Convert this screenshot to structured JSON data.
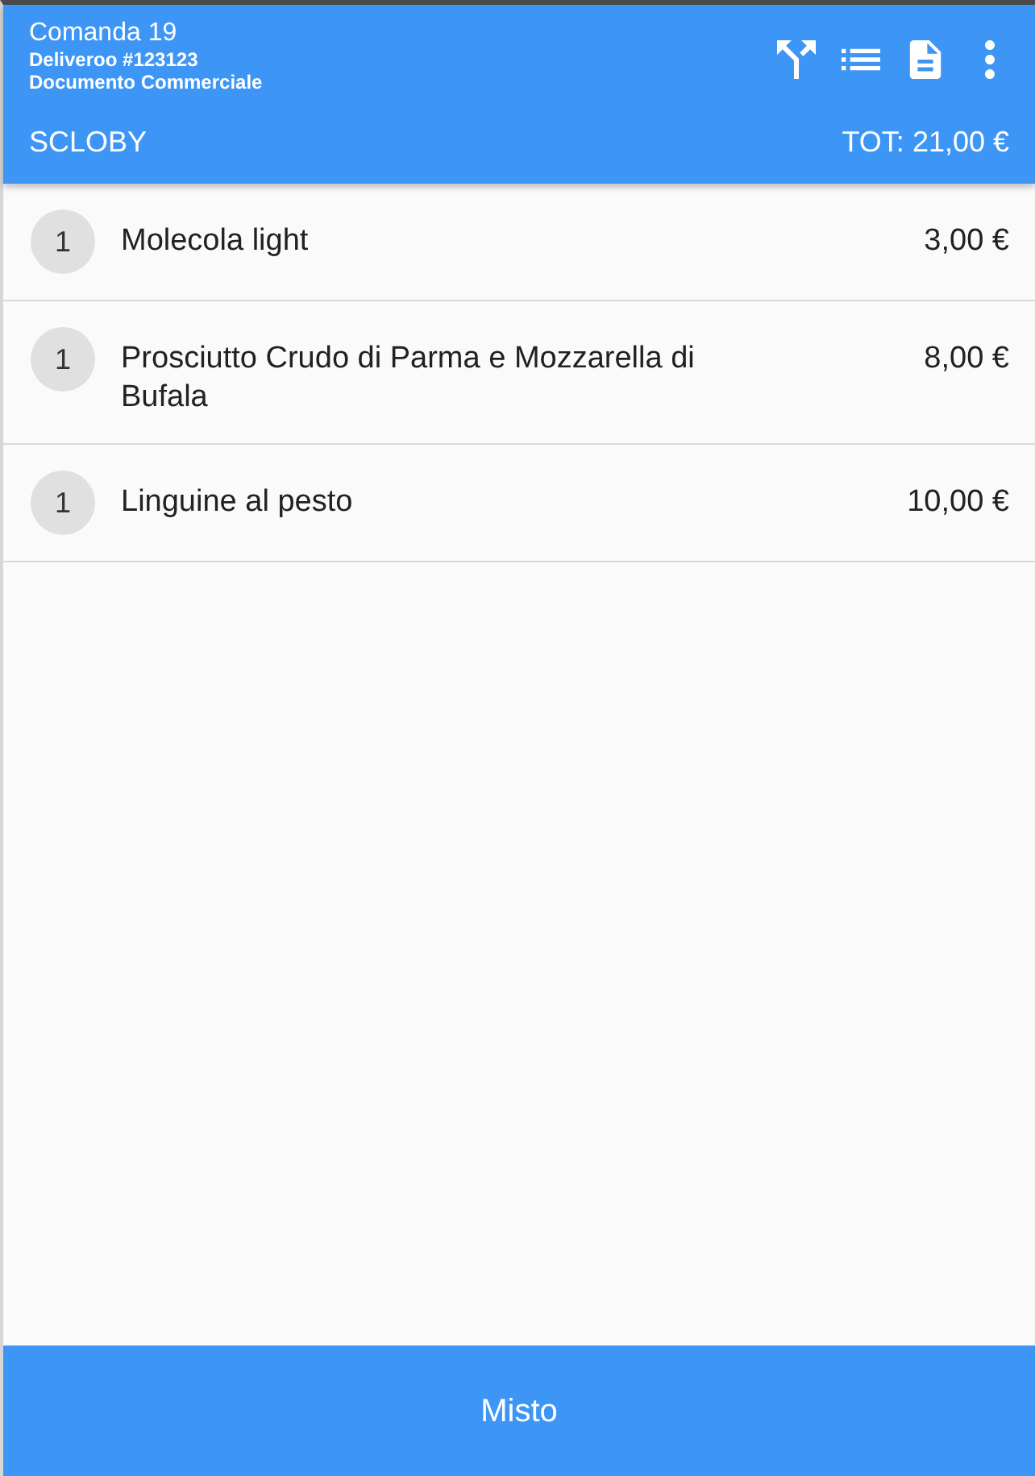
{
  "header": {
    "title": "Comanda 19",
    "subtitle": "Deliveroo #123123",
    "document_type": "Documento Commerciale",
    "shop_name": "SCLOBY",
    "total": "TOT: 21,00 €"
  },
  "items": [
    {
      "quantity": "1",
      "name": "Molecola light",
      "price": "3,00 €"
    },
    {
      "quantity": "1",
      "name": "Prosciutto Crudo di Parma e Mozzarella di Bufala",
      "price": "8,00 €"
    },
    {
      "quantity": "1",
      "name": "Linguine al pesto",
      "price": "10,00 €"
    }
  ],
  "footer_button": {
    "label": "Misto"
  }
}
